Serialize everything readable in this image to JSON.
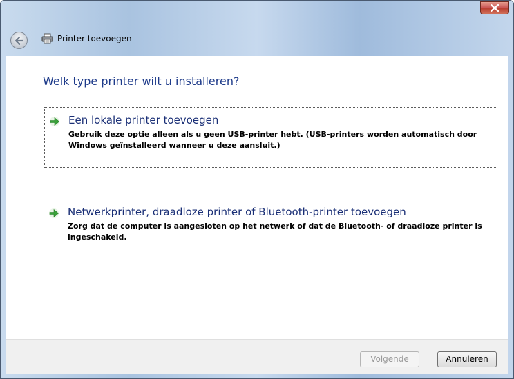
{
  "window": {
    "title": "Printer toevoegen"
  },
  "heading": "Welk type printer wilt u installeren?",
  "options": [
    {
      "title": "Een lokale printer toevoegen",
      "description": "Gebruik deze optie alleen als u geen USB-printer hebt. (USB-printers worden automatisch door Windows geïnstalleerd wanneer u deze aansluit.)",
      "selected": true,
      "icon": "green-arrow-icon"
    },
    {
      "title": "Netwerkprinter, draadloze printer of Bluetooth-printer toevoegen",
      "description": "Zorg dat de computer is aangesloten op het netwerk of dat de Bluetooth- of draadloze printer is ingeschakeld.",
      "selected": false,
      "icon": "green-arrow-icon"
    }
  ],
  "buttons": {
    "next_label": "Volgende",
    "next_enabled": false,
    "cancel_label": "Annuleren"
  },
  "colors": {
    "heading": "#1e3b8a",
    "option_title": "#1a2f76",
    "arrow": "#3aa23a",
    "close_button": "#c75050"
  }
}
